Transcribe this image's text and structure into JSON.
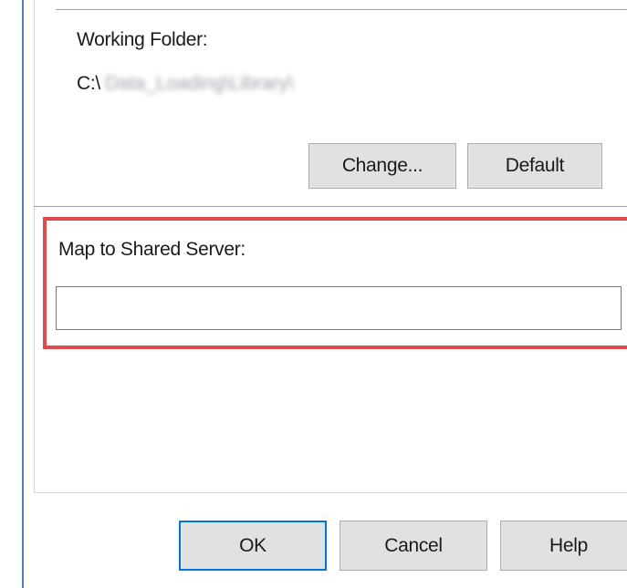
{
  "working_folder": {
    "label": "Working Folder:",
    "path_prefix": "C:\\",
    "path_obscured": "Data_Loading\\Library\\",
    "change_button": "Change...",
    "default_button": "Default"
  },
  "shared_server": {
    "label": "Map to Shared Server:",
    "value": "",
    "placeholder": ""
  },
  "dialog_buttons": {
    "ok": "OK",
    "cancel": "Cancel",
    "help": "Help"
  },
  "colors": {
    "highlight_border": "#e04a4a",
    "default_button_border": "#0078d7"
  }
}
